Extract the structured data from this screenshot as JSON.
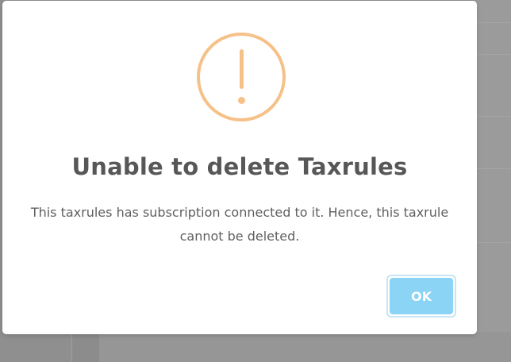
{
  "dialog": {
    "icon": "warning-exclamation-icon",
    "title": "Unable to delete Taxrules",
    "message": "This taxrules has subscription connected to it. Hence, this taxrule cannot be deleted.",
    "ok_label": "OK"
  },
  "colors": {
    "warning": "#f6c189",
    "ok_button": "#8cd4f5",
    "title_text": "#575757",
    "overlay": "#8f8f8f"
  }
}
